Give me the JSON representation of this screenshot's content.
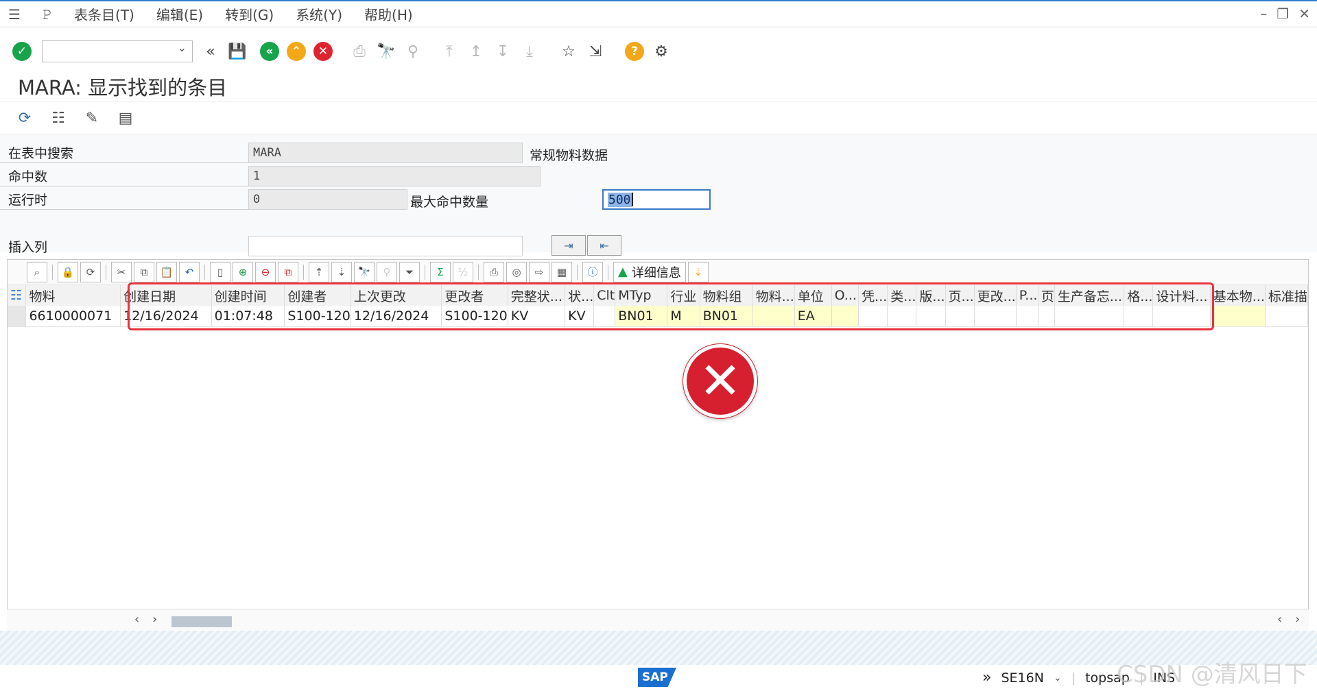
{
  "menubar": {
    "items": [
      "表条目(T)",
      "编辑(E)",
      "转到(G)",
      "系统(Y)",
      "帮助(H)"
    ]
  },
  "window": {
    "minimize_icon": "minimize-icon",
    "restore_icon": "restore-icon",
    "close_icon": "close-icon"
  },
  "page": {
    "title": "MARA: 显示找到的条目"
  },
  "form": {
    "search_table_label": "在表中搜索",
    "search_table_value": "MARA",
    "search_table_desc": "常规物料数据",
    "hits_label": "命中数",
    "hits_value": "1",
    "runtime_label": "运行时",
    "runtime_value": "0",
    "max_hits_label": "最大命中数量",
    "max_hits_value": "500",
    "insert_col_label": "插入列",
    "insert_col_value": ""
  },
  "grid": {
    "detail_button_label": "详细信息",
    "columns": [
      "物料",
      "创建日期",
      "创建时间",
      "创建者",
      "上次更改",
      "更改者",
      "完整状...",
      "状...",
      "Clt",
      "MTyp",
      "行业",
      "物料组",
      "物料...",
      "单位",
      "O...",
      "凭...",
      "类...",
      "版...",
      "页...",
      "更改...",
      "P...",
      "页",
      "生产备忘...",
      "格...",
      "设计料...",
      "基本物...",
      "标准描"
    ],
    "rows": [
      [
        "6610000071",
        "12/16/2024",
        "01:07:48",
        "S100-120",
        "12/16/2024",
        "S100-120",
        "KV",
        "KV",
        "",
        "BN01",
        "M",
        "BN01",
        "",
        "EA",
        "",
        "",
        "",
        "",
        "",
        "",
        "",
        "",
        "",
        "",
        "",
        "",
        ""
      ]
    ]
  },
  "status": {
    "logo": "SAP",
    "transaction": "SE16N",
    "system": "topsap",
    "mode": "INS"
  },
  "watermark": "CSDN @清风日下",
  "colors": {
    "accent_blue": "#2f7dcf",
    "error_red": "#d6202f",
    "highlight_box": "#e8323c",
    "key_field_yellow": "#ffffcc"
  }
}
